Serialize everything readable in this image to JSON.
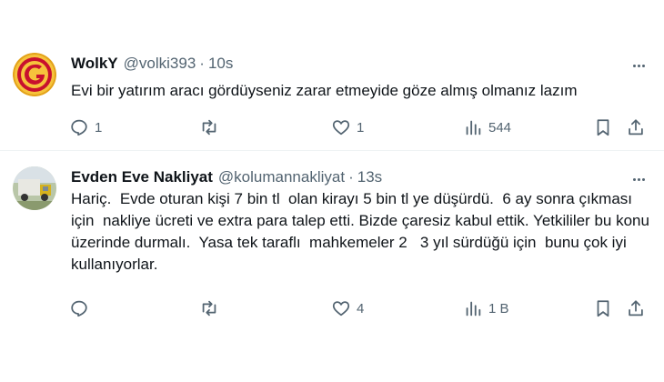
{
  "colors": {
    "muted": "#536471",
    "text": "#0f1419",
    "divider": "#eff3f4"
  },
  "tweets": [
    {
      "name": "WolkY",
      "handle": "@volki393",
      "separator": "·",
      "time": "10s",
      "text": "Evi bir yatırım aracı gördüyseniz zarar etmeyide göze almış olmanız lazım",
      "replies": "1",
      "retweets": "",
      "likes": "1",
      "views": "544",
      "avatar_icon": "galatasaray-logo"
    },
    {
      "name": "Evden Eve Nakliyat",
      "handle": "@kolumannakliyat",
      "separator": "·",
      "time": "13s",
      "text": "Hariç.  Evde oturan kişi 7 bin tl  olan kirayı 5 bin tl ye düşürdü.  6 ay sonra çıkması için  nakliye ücreti ve extra para talep etti. Bizde çaresiz kabul ettik. Yetkililer bu konu üzerinde durmalı.  Yasa tek taraflı  mahkemeler 2   3 yıl sürdüğü için  bunu çok iyi kullanıyorlar.",
      "replies": "",
      "retweets": "",
      "likes": "4",
      "views": "1 B",
      "avatar_icon": "moving-truck-photo"
    }
  ]
}
